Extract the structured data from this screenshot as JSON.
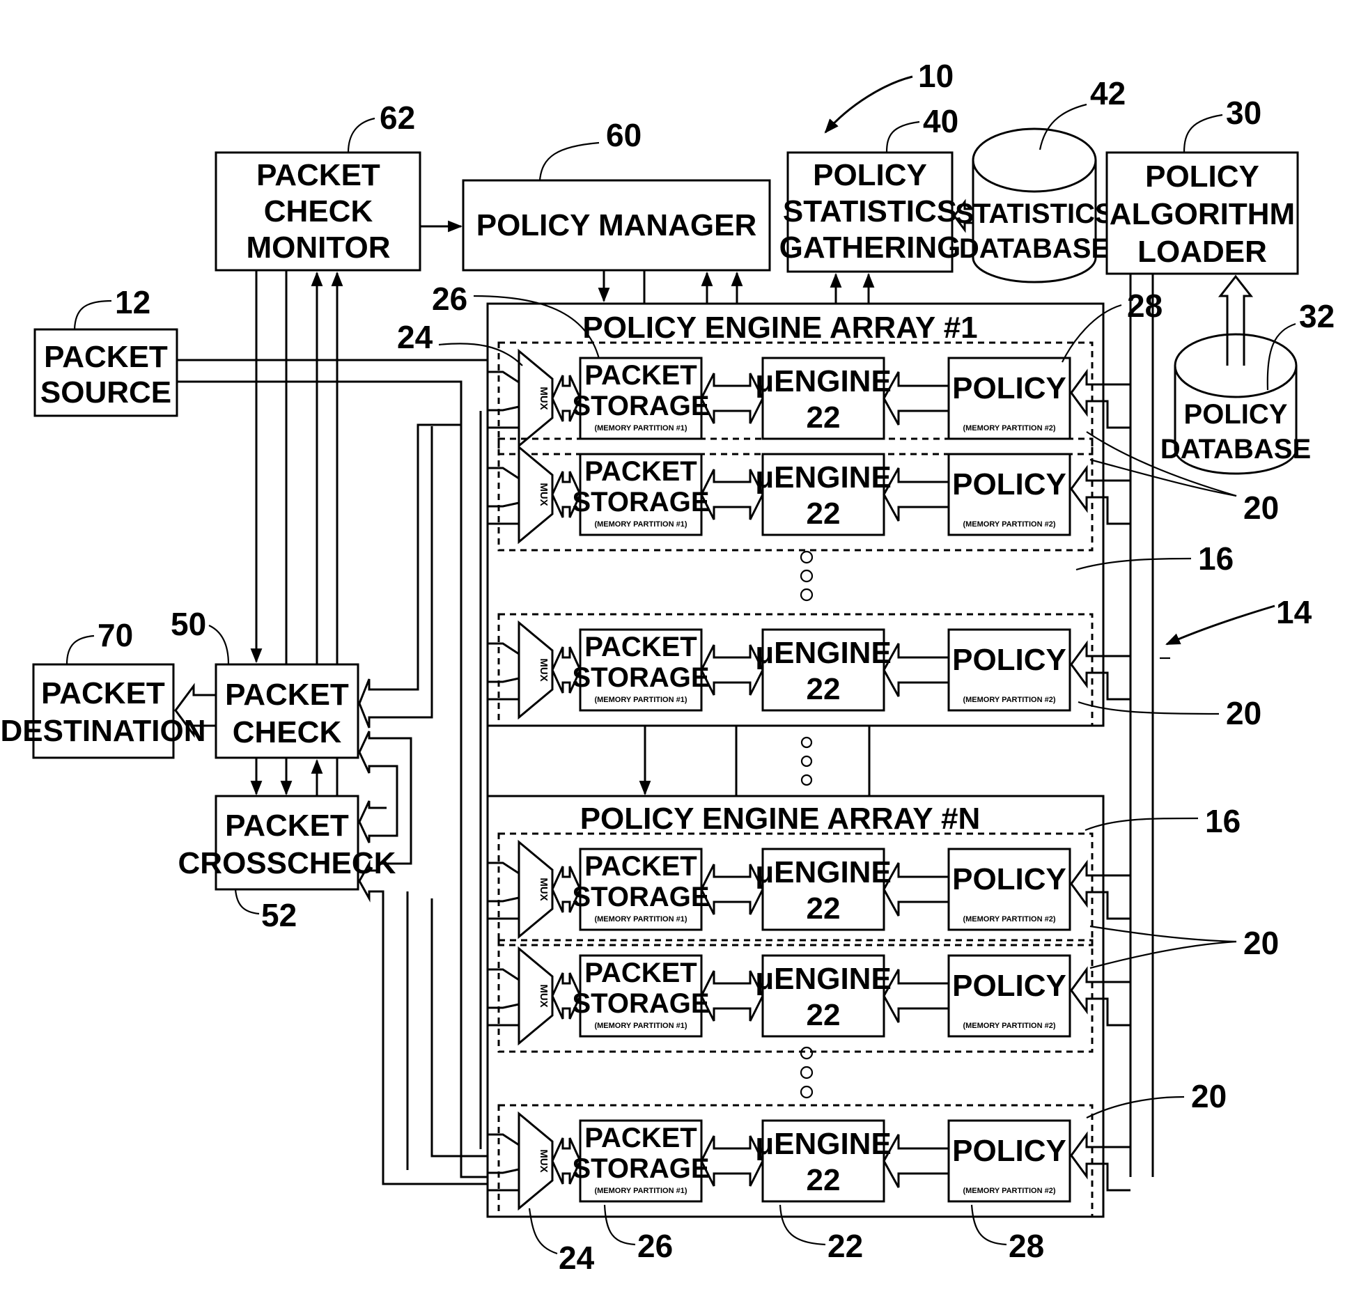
{
  "figure": {
    "system_ref": "10",
    "blocks": {
      "packet_check_monitor": {
        "lines": [
          "PACKET",
          "CHECK",
          "MONITOR"
        ],
        "ref": "62"
      },
      "policy_manager": {
        "lines": [
          "POLICY MANAGER"
        ],
        "ref": "60"
      },
      "policy_statistics_gathering": {
        "lines": [
          "POLICY",
          "STATISTICS",
          "GATHERING"
        ],
        "ref": "40"
      },
      "statistics_database": {
        "lines": [
          "STATISTICS",
          "DATABASE"
        ],
        "ref": "42"
      },
      "policy_algorithm_loader": {
        "lines": [
          "POLICY",
          "ALGORITHM",
          "LOADER"
        ],
        "ref": "30"
      },
      "policy_database": {
        "lines": [
          "POLICY",
          "DATABASE"
        ],
        "ref": "32"
      },
      "packet_source": {
        "lines": [
          "PACKET",
          "SOURCE"
        ],
        "ref": "12"
      },
      "packet_destination": {
        "lines": [
          "PACKET",
          "DESTINATION"
        ],
        "ref": "70"
      },
      "packet_check": {
        "lines": [
          "PACKET",
          "CHECK"
        ],
        "ref": "50"
      },
      "packet_crosscheck": {
        "lines": [
          "PACKET",
          "CROSSCHECK"
        ],
        "ref": "52"
      }
    },
    "arrays": [
      {
        "title": "POLICY ENGINE ARRAY #1",
        "ref": "16"
      },
      {
        "title": "POLICY ENGINE ARRAY #N",
        "ref": "16"
      }
    ],
    "engine_row": {
      "mux_label": "MUX",
      "packet_storage": [
        "PACKET",
        "STORAGE"
      ],
      "packet_storage_sub": "(MEMORY PARTITION #1)",
      "uengine": [
        "μENGINE",
        "22"
      ],
      "policy": "POLICY",
      "policy_sub": "(MEMORY PARTITION #2)",
      "row_ref": "20"
    },
    "refs": {
      "mux": "24",
      "packet_storage": "26",
      "uengine": "22",
      "policy_memory": "28",
      "engine_group": "14",
      "engine_row": "20",
      "array": "16"
    },
    "ellipsis": "o o o"
  }
}
